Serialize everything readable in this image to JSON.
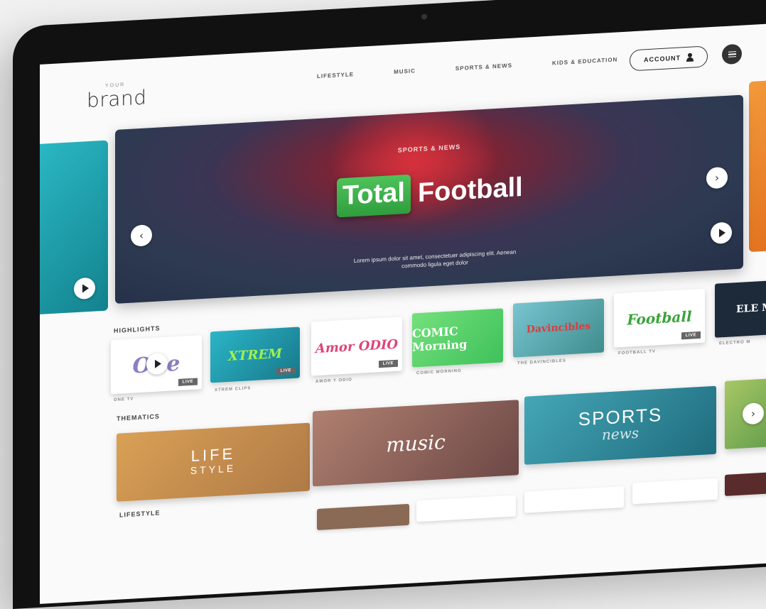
{
  "header": {
    "logo_small": "YOUR",
    "logo_big": "brand",
    "nav": [
      "LIFESTYLE",
      "MUSIC",
      "SPORTS & NEWS",
      "KIDS & EDUCATION"
    ],
    "account_label": "ACCOUNT",
    "account_icon": "user-icon",
    "menu_icon": "hamburger-menu-icon"
  },
  "hero": {
    "kicker": "SPORTS & NEWS",
    "title_badge": "Total",
    "title_rest": "Football",
    "description": "Lorem ipsum dolor sit amet, consectetuer adipiscing elit. Aenean commodo ligula eget dolor",
    "prev_icon": "chevron-left-icon",
    "next_icon": "chevron-right-icon",
    "play_icon": "play-icon"
  },
  "highlights": {
    "title": "HIGHLIGHTS",
    "items": [
      {
        "name": "ONE TV",
        "logo": "One",
        "live": "LIVE",
        "color": "#ffffff"
      },
      {
        "name": "XTREM CLIPS",
        "logo": "XTREM",
        "live": "LIVE",
        "color": "#1d9fb3"
      },
      {
        "name": "AMOR Y ODIO",
        "logo": "Amor ODIO",
        "live": "LIVE",
        "color": "#ffffff"
      },
      {
        "name": "COMIC MORNING",
        "logo": "COMIC Morning",
        "live": "",
        "color": "#5fd36a"
      },
      {
        "name": "THE DAVINCIBLES",
        "logo": "Davincibles",
        "live": "",
        "color": "#5aa7b8"
      },
      {
        "name": "FOOTBALL TV",
        "logo": "Football",
        "live": "LIVE",
        "color": "#ffffff"
      },
      {
        "name": "ELECTRO M",
        "logo": "ELE M",
        "live": "",
        "color": "#1c2a3a"
      }
    ]
  },
  "thematics": {
    "title": "THEMATICS",
    "items": [
      {
        "label_line1": "LIFE",
        "label_line2": "STYLE",
        "color": "#c99a55"
      },
      {
        "label_line1": "music",
        "label_line2": "",
        "color": "#8a5a55"
      },
      {
        "label_line1": "SPORTS",
        "label_line2": "news",
        "color": "#2f8fa0"
      }
    ],
    "next_icon": "chevron-right-icon"
  },
  "lifestyle": {
    "title": "LIFESTYLE"
  }
}
